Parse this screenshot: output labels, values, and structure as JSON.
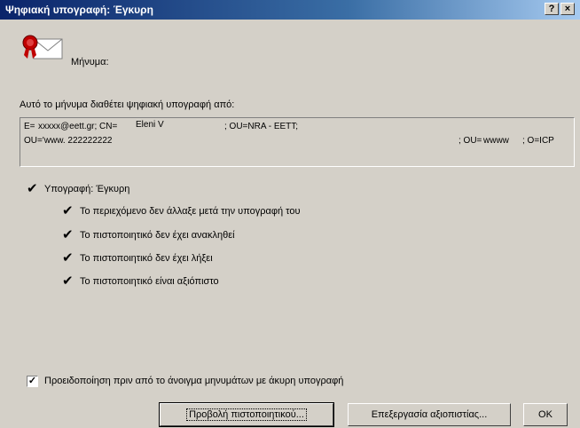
{
  "window": {
    "title": "Ψηφιακή υπογραφή: Έγκυρη",
    "help_button": "?",
    "close_button": "×"
  },
  "header": {
    "message_label": "Μήνυμα:"
  },
  "signed_by": {
    "label": "Αυτό το μήνυμα διαθέτει ψηφιακή υπογραφή από:",
    "line1_a": "E=",
    "line1_b": "xxxxx@eett.gr; CN=",
    "line1_c": "Eleni V",
    "line1_d": "; OU=NRA - EETT;",
    "line2_a": "OU='www. 222222222",
    "line2_b": "; OU=",
    "line2_c": "wwww",
    "line2_d": "; O=ICP"
  },
  "status": {
    "signature": "Υπογραφή: Έγκυρη",
    "checks": [
      "Το περιεχόμενο δεν άλλαξε μετά την υπογραφή του",
      "Το πιστοποιητικό δεν έχει ανακληθεί",
      "Το πιστοποιητικό δεν έχει λήξει",
      "Το πιστοποιητικό είναι αξιόπιστο"
    ]
  },
  "options": {
    "warn_checkbox_label": "Προειδοποίηση πριν από το άνοιγμα μηνυμάτων με άκυρη υπογραφή",
    "warn_checked": true
  },
  "buttons": {
    "view_certificate": "Προβολή πιστοποιητικού...",
    "edit_trust": "Επεξεργασία αξιοπιστίας...",
    "ok": "OK"
  },
  "icons": {
    "message_icon": "signed-envelope-icon",
    "check_icon": "checkmark-icon"
  },
  "colors": {
    "title_gradient_start": "#0a246a",
    "title_gradient_end": "#a6caf0",
    "dialog_bg": "#d4d0c8"
  }
}
